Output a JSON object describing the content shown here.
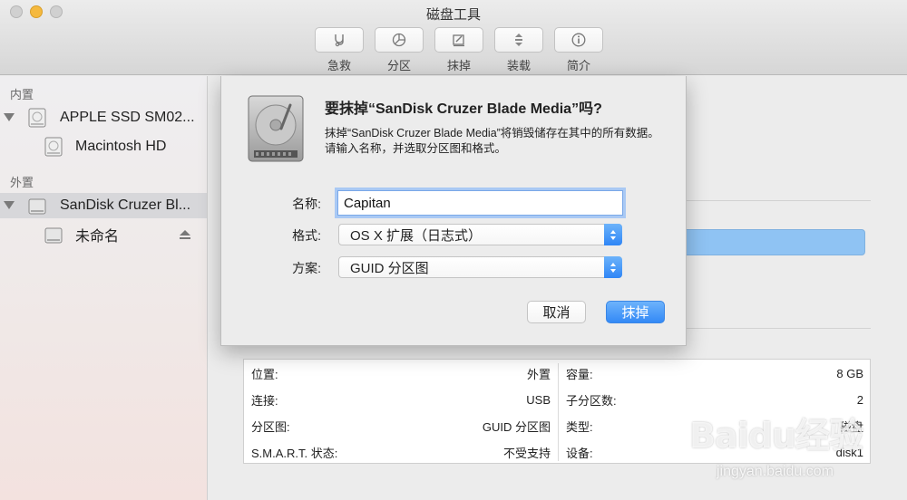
{
  "window": {
    "title": "磁盘工具"
  },
  "toolbar": [
    {
      "label": "急救",
      "icon": "stethoscope-icon"
    },
    {
      "label": "分区",
      "icon": "pie-chart-icon"
    },
    {
      "label": "抹掉",
      "icon": "erase-icon"
    },
    {
      "label": "装载",
      "icon": "mount-icon"
    },
    {
      "label": "简介",
      "icon": "info-icon"
    }
  ],
  "sidebar": {
    "internal_header": "内置",
    "external_header": "外置",
    "internal": [
      {
        "label": "APPLE SSD SM02...",
        "level": 0
      },
      {
        "label": "Macintosh HD",
        "level": 1
      }
    ],
    "external": [
      {
        "label": "SanDisk Cruzer Bl...",
        "level": 0,
        "selected": true
      },
      {
        "label": "未命名",
        "level": 1,
        "ejectable": true
      }
    ]
  },
  "sheet": {
    "title": "要抹掉“SanDisk Cruzer Blade Media”吗?",
    "description": "抹掉“SanDisk Cruzer Blade Media”将销毁储存在其中的所有数据。请输入名称，并选取分区图和格式。",
    "name_label": "名称:",
    "name_value": "Capitan",
    "format_label": "格式:",
    "format_value": "OS X 扩展（日志式）",
    "scheme_label": "方案:",
    "scheme_value": "GUID 分区图",
    "cancel_label": "取消",
    "erase_label": "抹掉"
  },
  "info": {
    "left": [
      {
        "key": "位置:",
        "value": "外置"
      },
      {
        "key": "连接:",
        "value": "USB"
      },
      {
        "key": "分区图:",
        "value": "GUID 分区图"
      },
      {
        "key": "S.M.A.R.T. 状态:",
        "value": "不受支持"
      }
    ],
    "right": [
      {
        "key": "容量:",
        "value": "8 GB"
      },
      {
        "key": "子分区数:",
        "value": "2"
      },
      {
        "key": "类型:",
        "value": "磁盘"
      },
      {
        "key": "设备:",
        "value": "disk1"
      }
    ]
  },
  "watermark": {
    "logo": "Baidu经验",
    "url": "jingyan.baidu.com"
  },
  "colors": {
    "accent": "#3389f6",
    "selection": "#d7d7da",
    "usage_bar": "#8fc3f3"
  }
}
